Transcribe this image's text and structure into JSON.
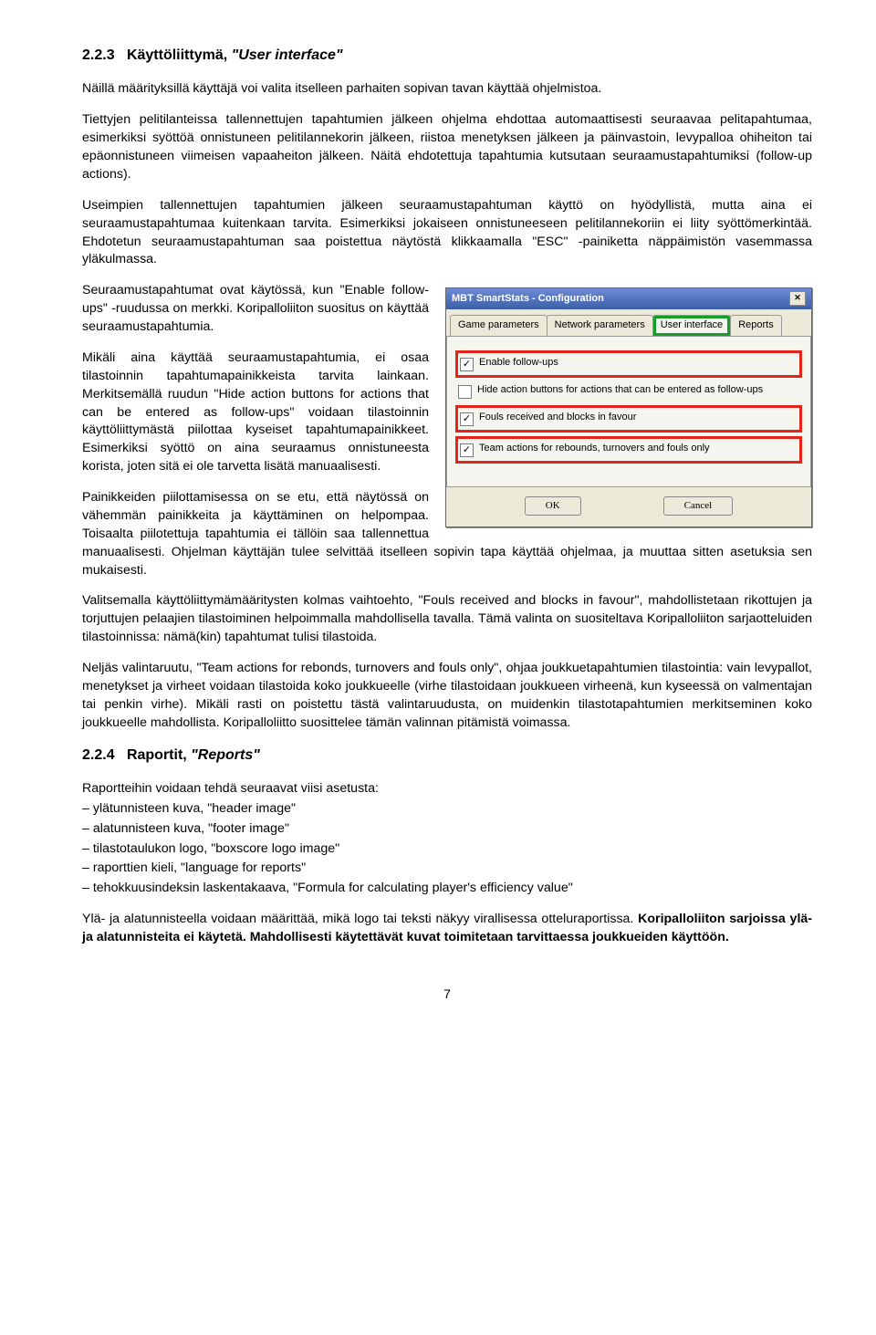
{
  "section1": {
    "number": "2.2.3",
    "title_plain": "Käyttöliittymä,",
    "title_italic": "\"User interface\""
  },
  "p1": "Näillä määrityksillä käyttäjä voi valita itselleen parhaiten sopivan tavan käyttää ohjelmistoa.",
  "p2": "Tiettyjen pelitilanteissa tallennettujen tapahtumien jälkeen ohjelma ehdottaa automaattisesti seuraavaa pelitapahtumaa, esimerkiksi syöttöä onnistuneen pelitilannekorin jälkeen, riistoa menetyksen jälkeen ja päinvastoin, levypalloa ohiheiton tai epäonnistuneen viimeisen vapaaheiton jälkeen. Näitä ehdotettuja tapahtumia kutsutaan seuraamustapahtumiksi (follow-up actions).",
  "p3": "Useimpien tallennettujen tapahtumien jälkeen seuraamustapahtuman käyttö on hyödyllistä, mutta aina ei seuraamustapahtumaa kuitenkaan tarvita. Esimerkiksi jokaiseen onnistuneeseen pelitilannekoriin ei liity syöttömerkintää. Ehdotetun seuraamustapahtuman saa poistettua näytöstä klikkaamalla \"ESC\" -painiketta näppäimistön vasemmassa yläkulmassa.",
  "p4": "Seuraamustapahtumat ovat käytössä, kun \"Enable follow-ups\" -ruudussa on merkki. Koripalloliiton suositus on käyttää seuraamustapahtumia.",
  "p5": "Mikäli aina käyttää seuraamustapahtumia, ei osaa tilastoinnin tapahtumapainikkeista tarvita lainkaan. Merkitsemällä ruudun \"Hide action buttons for actions that can be entered as follow-ups\" voidaan tilastoinnin käyttöliittymästä piilottaa kyseiset tapahtumapainikkeet. Esimerkiksi syöttö on aina seuraamus onnistuneesta korista, joten sitä ei ole tarvetta lisätä manuaalisesti.",
  "p6": "Painikkeiden piilottamisessa on se etu, että näytössä on vähemmän painikkeita ja käyttäminen on helpompaa. Toisaalta piilotettuja tapahtumia ei tällöin saa tallennettua manuaalisesti. Ohjelman käyttäjän tulee selvittää itselleen sopivin tapa käyttää ohjelmaa, ja muuttaa sitten asetuksia sen mukaisesti.",
  "p7": "Valitsemalla käyttöliittymämääritysten kolmas vaihtoehto, \"Fouls received and blocks in favour\", mahdollistetaan rikottujen ja torjuttujen pelaajien tilastoiminen helpoimmalla mahdollisella tavalla. Tämä valinta on suositeltava Koripalloliiton sarjaotteluiden tilastoinnissa: nämä(kin) tapahtumat tulisi tilastoida.",
  "p8": "Neljäs valintaruutu, \"Team actions for rebonds, turnovers and fouls only\", ohjaa joukkuetapahtumien tilastointia: vain levypallot, menetykset ja virheet voidaan tilastoida koko joukkueelle (virhe tilastoidaan joukkueen virheenä, kun kyseessä on valmentajan tai penkin virhe). Mikäli rasti on poistettu tästä valintaruudusta, on muidenkin tilastotapahtumien merkitseminen koko joukkueelle mahdollista. Koripalloliitto suosittelee tämän valinnan pitämistä voimassa.",
  "section2": {
    "number": "2.2.4",
    "title_plain": "Raportit,",
    "title_italic": "\"Reports\""
  },
  "p9": "Raportteihin voidaan tehdä seuraavat viisi asetusta:",
  "list": {
    "i0": "ylätunnisteen kuva, \"header image\"",
    "i1": "alatunnisteen kuva, \"footer image\"",
    "i2": "tilastotaulukon logo, \"boxscore logo image\"",
    "i3": "raporttien kieli, \"language for reports\"",
    "i4": "tehokkuusindeksin laskentakaava, \"Formula for calculating player's efficiency value\""
  },
  "p10a": "Ylä- ja alatunnisteella voidaan määrittää, mikä logo tai teksti näkyy virallisessa otteluraportissa. ",
  "p10b": "Koripalloliiton sarjoissa ylä- ja alatunnisteita ei käytetä. Mahdollisesti käytettävät kuvat toimitetaan tarvittaessa joukkueiden käyttöön.",
  "dialog": {
    "title": "MBT SmartStats - Configuration",
    "tabs": {
      "t0": "Game parameters",
      "t1": "Network parameters",
      "t2": "User interface",
      "t3": "Reports"
    },
    "opts": {
      "o0": "Enable follow-ups",
      "o1": "Hide action buttons for actions that can be entered as follow-ups",
      "o2": "Fouls received and blocks in favour",
      "o3": "Team actions for rebounds, turnovers and fouls only"
    },
    "ok": "OK",
    "cancel": "Cancel"
  },
  "pagenum": "7"
}
